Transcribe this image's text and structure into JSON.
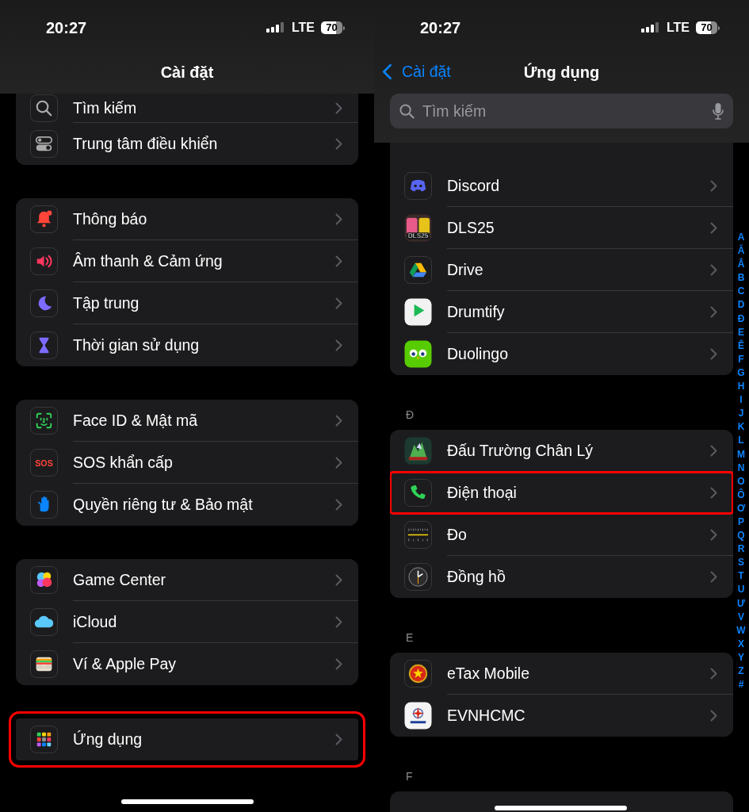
{
  "panels": [
    {
      "status_bar": {
        "time": "20:27",
        "network": "LTE",
        "battery": "70"
      },
      "title": "Cài đặt",
      "groups": [
        {
          "rows": [
            {
              "label": "Tìm kiếm",
              "highlighted": false
            },
            {
              "label": "Trung tâm điều khiển",
              "highlighted": false
            }
          ]
        },
        {
          "rows": [
            {
              "label": "Thông báo",
              "highlighted": false
            },
            {
              "label": "Âm thanh & Cảm ứng",
              "highlighted": false
            },
            {
              "label": "Tập trung",
              "highlighted": false
            },
            {
              "label": "Thời gian sử dụng",
              "highlighted": false
            }
          ]
        },
        {
          "rows": [
            {
              "label": "Face ID & Mật mã",
              "highlighted": false
            },
            {
              "label": "SOS khẩn cấp",
              "icon_text": "SOS",
              "highlighted": false
            },
            {
              "label": "Quyền riêng tư & Bảo mật",
              "highlighted": false
            }
          ]
        },
        {
          "rows": [
            {
              "label": "Game Center",
              "highlighted": false
            },
            {
              "label": "iCloud",
              "highlighted": false
            },
            {
              "label": "Ví & Apple Pay",
              "highlighted": false
            }
          ]
        },
        {
          "rows": [
            {
              "label": "Ứng dụng",
              "highlighted": true
            }
          ]
        }
      ]
    },
    {
      "status_bar": {
        "time": "20:27",
        "network": "LTE",
        "battery": "70"
      },
      "back": "Cài đặt",
      "title": "Ứng dụng",
      "search": {
        "placeholder": "Tìm kiếm"
      },
      "groups": [
        {
          "rows": [
            {
              "label": "Discord",
              "highlighted": false
            },
            {
              "label": "DLS25",
              "icon_text": "DLS25",
              "highlighted": false
            },
            {
              "label": "Drive",
              "highlighted": false
            },
            {
              "label": "Drumtify",
              "highlighted": false
            },
            {
              "label": "Duolingo",
              "highlighted": false
            }
          ]
        },
        {
          "header": "Đ",
          "rows": [
            {
              "label": "Đấu Trường Chân Lý",
              "highlighted": false
            },
            {
              "label": "Điện thoại",
              "highlighted": true
            },
            {
              "label": "Đo",
              "highlighted": false
            },
            {
              "label": "Đồng hồ",
              "highlighted": false
            }
          ]
        },
        {
          "header": "E",
          "rows": [
            {
              "label": "eTax Mobile",
              "highlighted": false
            },
            {
              "label": "EVNHCMC",
              "highlighted": false
            }
          ]
        },
        {
          "header": "F"
        }
      ],
      "index": [
        "A",
        "Ă",
        "Â",
        "B",
        "C",
        "D",
        "Đ",
        "E",
        "Ê",
        "F",
        "G",
        "H",
        "I",
        "J",
        "K",
        "L",
        "M",
        "N",
        "O",
        "Ô",
        "Ơ",
        "P",
        "Q",
        "R",
        "S",
        "T",
        "U",
        "Ư",
        "V",
        "W",
        "X",
        "Y",
        "Z",
        "#"
      ]
    }
  ]
}
